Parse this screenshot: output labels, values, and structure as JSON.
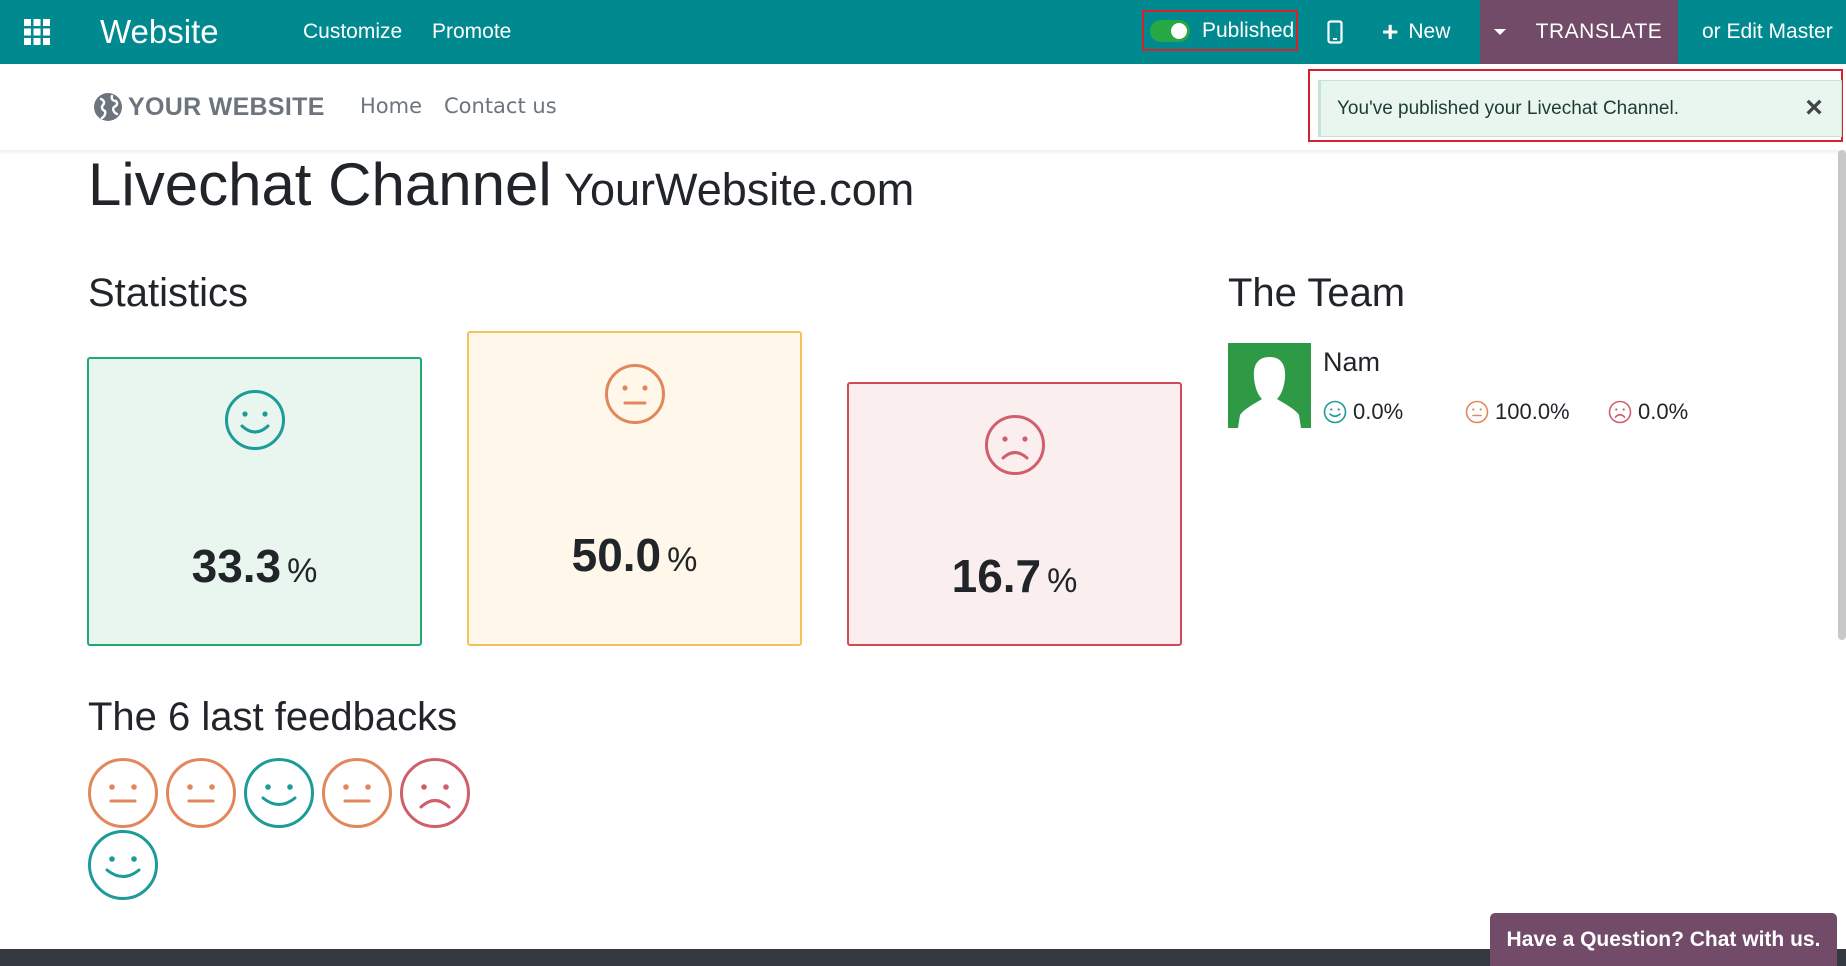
{
  "topbar": {
    "apps_icon": "grid-icon",
    "brand": "Website",
    "menu": [
      "Customize",
      "Promote"
    ],
    "published_label": "Published",
    "mobile_icon": "mobile-phone-icon",
    "new_label": "New",
    "translate_label": "TRANSLATE",
    "edit_master_label": "or Edit Master"
  },
  "site_header": {
    "logo_text": "YOUR WEBSITE",
    "logo_icon": "globe-icon",
    "nav": [
      "Home",
      "Contact us"
    ]
  },
  "notification": {
    "message": "You've published your Livechat Channel.",
    "close_icon": "close-icon"
  },
  "page": {
    "title": "Livechat Channel",
    "subtitle": "YourWebsite.com",
    "statistics_heading": "Statistics",
    "stats": [
      {
        "value": "33.3",
        "unit": "%",
        "icon": "happy-face-icon"
      },
      {
        "value": "50.0",
        "unit": "%",
        "icon": "neutral-face-icon"
      },
      {
        "value": "16.7",
        "unit": "%",
        "icon": "sad-face-icon"
      }
    ],
    "team_heading": "The Team",
    "team": [
      {
        "name": "Nam",
        "happy": "0.0%",
        "neutral": "100.0%",
        "sad": "0.0%"
      }
    ],
    "feedbacks_heading": "The 6 last feedbacks",
    "feedbacks": [
      "neutral",
      "neutral",
      "happy",
      "neutral",
      "sad",
      "happy"
    ]
  },
  "chat_button": "Have a Question? Chat with us.",
  "colors": {
    "topbar": "#00898e",
    "accent_purple": "#714b67",
    "happy": "#1c9b98",
    "neutral": "#e2875c",
    "sad": "#d15e6c"
  }
}
